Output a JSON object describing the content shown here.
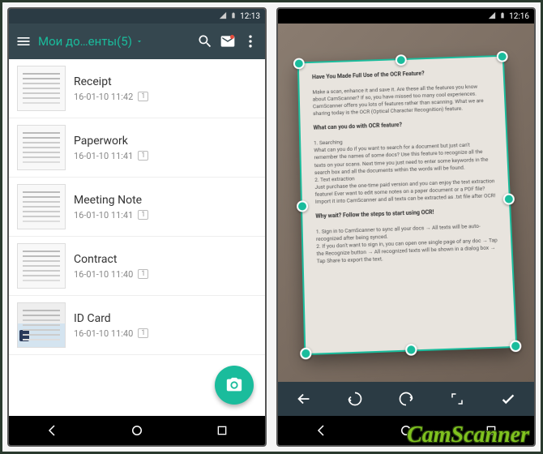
{
  "left": {
    "status_time": "12:13",
    "title": "Мои до…енты(5)",
    "docs": [
      {
        "title": "Receipt",
        "ts": "16-01-10 11:42",
        "pages": "1"
      },
      {
        "title": "Paperwork",
        "ts": "16-01-10 11:41",
        "pages": "1"
      },
      {
        "title": "Meeting Note",
        "ts": "16-01-10 11:41",
        "pages": "1"
      },
      {
        "title": "Contract",
        "ts": "16-01-10 11:40",
        "pages": "1"
      },
      {
        "title": "ID Card",
        "ts": "16-01-10 11:40",
        "pages": "1"
      }
    ]
  },
  "right": {
    "status_time": "12:16",
    "paper": {
      "h1": "Have You Made Full Use of the OCR Feature?",
      "p1": "Make a scan, enhance it and save it. Are these all the features you know about CamScanner? If so, you have missed too many cool experiences. CamScanner offers you lots of features rather than scanning. What we are sharing today is the OCR (Optical Character Recognition) feature.",
      "h2": "What can you do with OCR feature?",
      "s1_h": "1. Searching",
      "s1_p": "What can you do if you want to search for a document but just can't remember the names of some docs? Use this feature to recognize all the texts on your scans. Next time you just need to enter some keywords in the search box and all the documents within the words will be found.",
      "s2_h": "2. Text extraction",
      "s2_p": "Just purchase the one-time paid version and you can enjoy the text extraction feature! Ever want to edit some notes on a paper document or a PDF file? Import it into CamScanner and all texts can be extracted as .txt file after OCR!",
      "h3": "Why wait? Follow the steps to start using OCR!",
      "step1": "1. Sign in to CamScanner to sync all your docs → All texts will be auto-recognized after being synced.",
      "step2": "2. If you don't want to sign in, you can open one single page of any doc → Tap the Recognize button → All recognized texts will be shown in a dialog box → Tap Share to export the text."
    }
  },
  "brand": "CamScanner"
}
